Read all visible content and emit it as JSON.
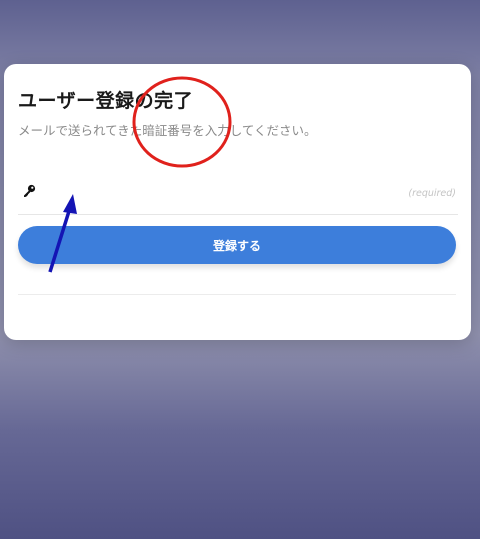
{
  "registration": {
    "title": "ユーザー登録の完了",
    "subtitle": "メールで送られてきた暗証番号を入力してください。",
    "code_field": {
      "icon": "key-icon",
      "value": "",
      "required_label": "(required)"
    },
    "submit_label": "登録する"
  },
  "annotations": {
    "circle_color": "#e0211c",
    "arrow_color": "#1414b4"
  },
  "colors": {
    "button": "#3d7edb",
    "card": "#ffffff"
  }
}
